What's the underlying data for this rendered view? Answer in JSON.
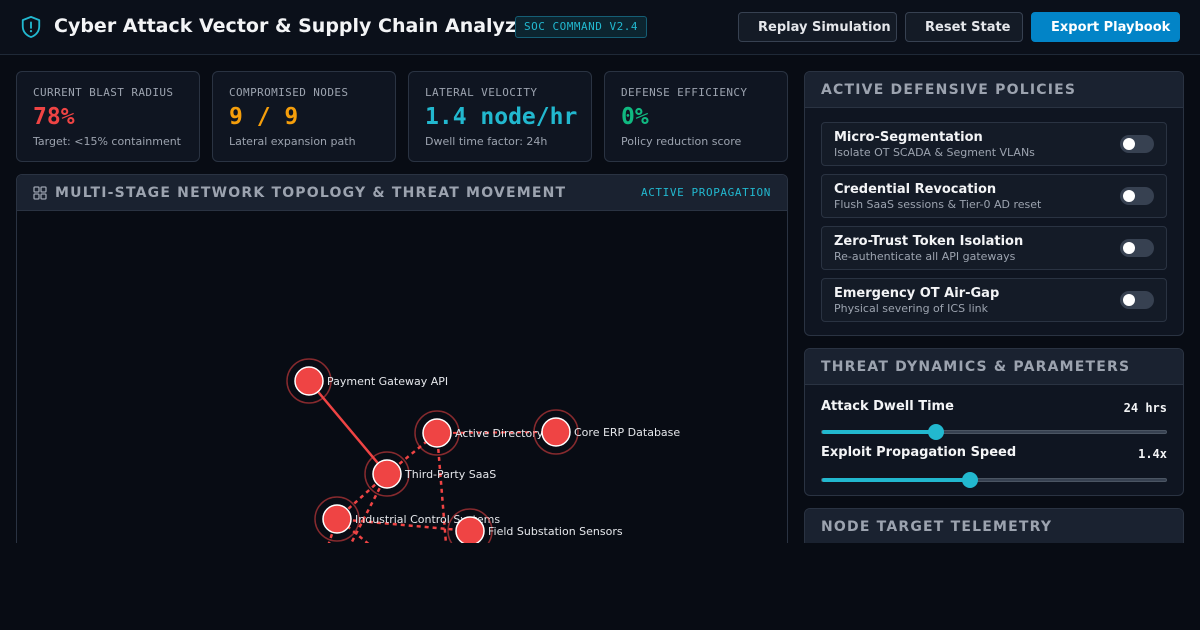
{
  "header": {
    "title": "Cyber Attack Vector & Supply Chain Analyzer",
    "version_badge": "SOC COMMAND V2.4",
    "brand_icon": "shield-alert-icon",
    "buttons": {
      "replay": "Replay Simulation",
      "reset": "Reset State",
      "export": "Export Playbook"
    }
  },
  "metrics": [
    {
      "label": "CURRENT BLAST RADIUS",
      "value": "78%",
      "sub": "Target: <15% containment",
      "color": "#ef4444"
    },
    {
      "label": "COMPROMISED NODES",
      "value": "9 / 9",
      "sub": "Lateral expansion path",
      "color": "#f59e0b"
    },
    {
      "label": "LATERAL VELOCITY",
      "value": "1.4 node/hr",
      "sub": "Dwell time factor: 24h",
      "color": "#22b8cf"
    },
    {
      "label": "DEFENSE EFFICIENCY",
      "value": "0%",
      "sub": "Policy reduction score",
      "color": "#10b981"
    }
  ],
  "topology": {
    "title": "MULTI-STAGE NETWORK TOPOLOGY & THREAT MOVEMENT",
    "status": "ACTIVE PROPAGATION",
    "nodes": [
      {
        "id": "payment",
        "label": "Payment Gateway API"
      },
      {
        "id": "ad",
        "label": "Active Directory"
      },
      {
        "id": "erp",
        "label": "Core ERP Database"
      },
      {
        "id": "saas",
        "label": "Third-Party SaaS"
      },
      {
        "id": "ics",
        "label": "Industrial Control Systems"
      },
      {
        "id": "field",
        "label": "Field Substation Sensors"
      }
    ],
    "node_color": "#ef4444",
    "edge_color": "#ef4444"
  },
  "policies": {
    "title": "ACTIVE DEFENSIVE POLICIES",
    "items": [
      {
        "title": "Micro-Segmentation",
        "desc": "Isolate OT SCADA & Segment VLANs",
        "enabled": false
      },
      {
        "title": "Credential Revocation",
        "desc": "Flush SaaS sessions & Tier-0 AD reset",
        "enabled": false
      },
      {
        "title": "Zero-Trust Token Isolation",
        "desc": "Re-authenticate all API gateways",
        "enabled": false
      },
      {
        "title": "Emergency OT Air-Gap",
        "desc": "Physical severing of ICS link",
        "enabled": false
      }
    ]
  },
  "dynamics": {
    "title": "THREAT DYNAMICS & PARAMETERS",
    "params": [
      {
        "label": "Attack Dwell Time",
        "value": "24 hrs",
        "fraction": 0.33
      },
      {
        "label": "Exploit Propagation Speed",
        "value": "1.4x",
        "fraction": 0.43
      }
    ]
  },
  "telemetry": {
    "title": "NODE TARGET TELEMETRY"
  }
}
